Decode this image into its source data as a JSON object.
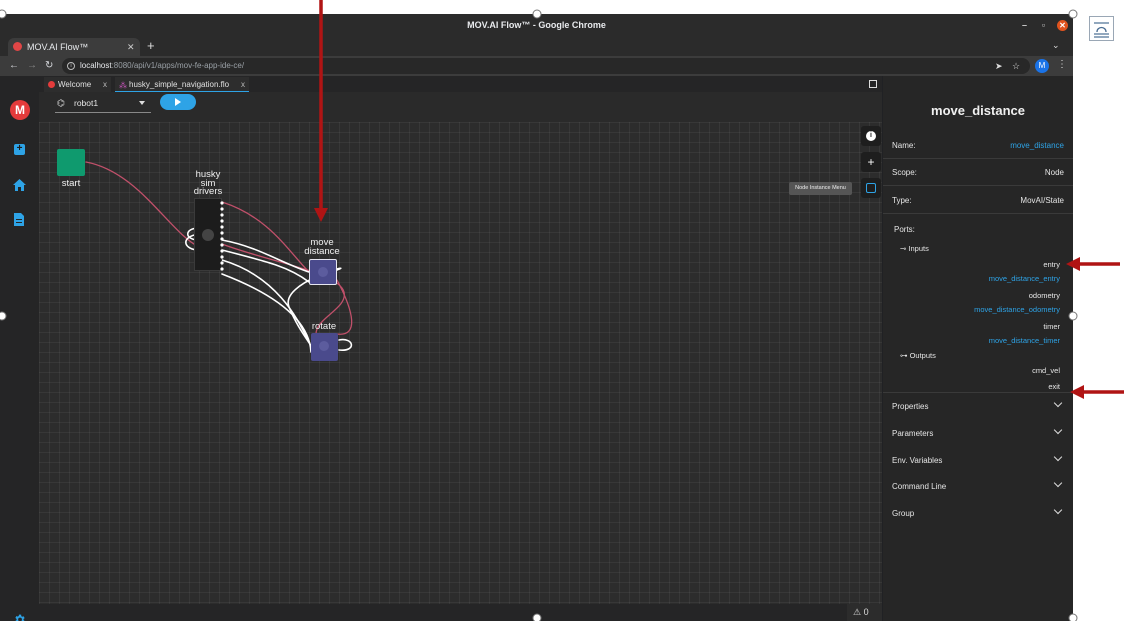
{
  "window": {
    "title": "MOV.AI Flow™ - Google Chrome"
  },
  "browser": {
    "tab_title": "MOV.AI Flow™",
    "url_host": "localhost",
    "url_rest": ":8080/api/v1/apps/mov-fe-app-ide-ce/",
    "profile_initial": "M"
  },
  "app": {
    "logo_letter": "M",
    "doc_tabs": [
      {
        "label": "Welcome",
        "close": "x"
      },
      {
        "label": "husky_simple_navigation.flo",
        "close": "x"
      }
    ],
    "robot_select": {
      "value": "robot1"
    },
    "tooltip": "Node Instance Menu",
    "warnings_count": "0"
  },
  "graph": {
    "nodes": {
      "start": "start",
      "husky": [
        "husky",
        "sim",
        "drivers"
      ],
      "move_distance": [
        "move",
        "distance"
      ],
      "rotate": "rotate"
    }
  },
  "panel": {
    "title": "move_distance",
    "name_label": "Name:",
    "name_value": "move_distance",
    "scope_label": "Scope:",
    "scope_value": "Node",
    "type_label": "Type:",
    "type_value": "MovAI/State",
    "ports_label": "Ports:",
    "inputs_label": "Inputs",
    "inputs": [
      {
        "port": "entry",
        "callback": "move_distance_entry"
      },
      {
        "port": "odometry",
        "callback": "move_distance_odometry"
      },
      {
        "port": "timer",
        "callback": "move_distance_timer"
      }
    ],
    "outputs_label": "Outputs",
    "outputs": [
      "cmd_vel",
      "exit"
    ],
    "sections": [
      "Properties",
      "Parameters",
      "Env. Variables",
      "Command Line",
      "Group"
    ]
  },
  "colors": {
    "accent_blue": "#2ea3e6",
    "start_node": "#0f9a6e",
    "state_node": "#4a4a8c",
    "annotation_arrow": "#b01414",
    "link_pink": "#c0506a"
  }
}
